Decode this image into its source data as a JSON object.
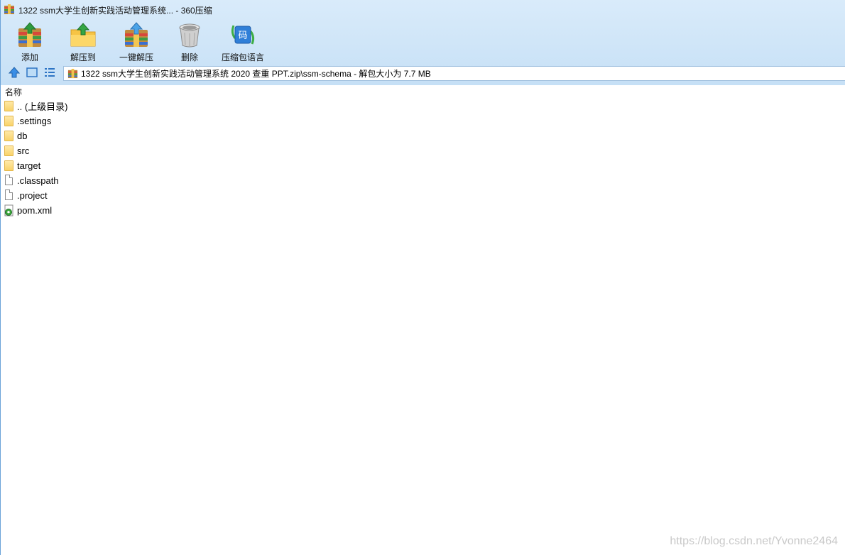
{
  "window": {
    "title": "1322 ssm大学生创新实践活动管理系统... - 360压缩"
  },
  "toolbar": {
    "items": [
      {
        "label": "添加",
        "icon": "add-archive-icon"
      },
      {
        "label": "解压到",
        "icon": "extract-to-icon"
      },
      {
        "label": "一键解压",
        "icon": "one-click-extract-icon"
      },
      {
        "label": "删除",
        "icon": "trash-icon"
      },
      {
        "label": "压缩包语言",
        "icon": "archive-language-icon"
      }
    ]
  },
  "nav": {
    "address": "1322 ssm大学生创新实践活动管理系统 2020 查重 PPT.zip\\ssm-schema - 解包大小为 7.7 MB"
  },
  "list": {
    "column_header": "名称",
    "items": [
      {
        "name": ".. (上级目录)",
        "type": "folder"
      },
      {
        "name": ".settings",
        "type": "folder"
      },
      {
        "name": "db",
        "type": "folder"
      },
      {
        "name": "src",
        "type": "folder"
      },
      {
        "name": "target",
        "type": "folder"
      },
      {
        "name": ".classpath",
        "type": "file"
      },
      {
        "name": ".project",
        "type": "file"
      },
      {
        "name": "pom.xml",
        "type": "xml"
      }
    ]
  },
  "watermark": "https://blog.csdn.net/Yvonne2464",
  "colors": {
    "chrome": "#cfe5f8",
    "accent": "#3a8ee6",
    "folder": "#f9d36a"
  }
}
